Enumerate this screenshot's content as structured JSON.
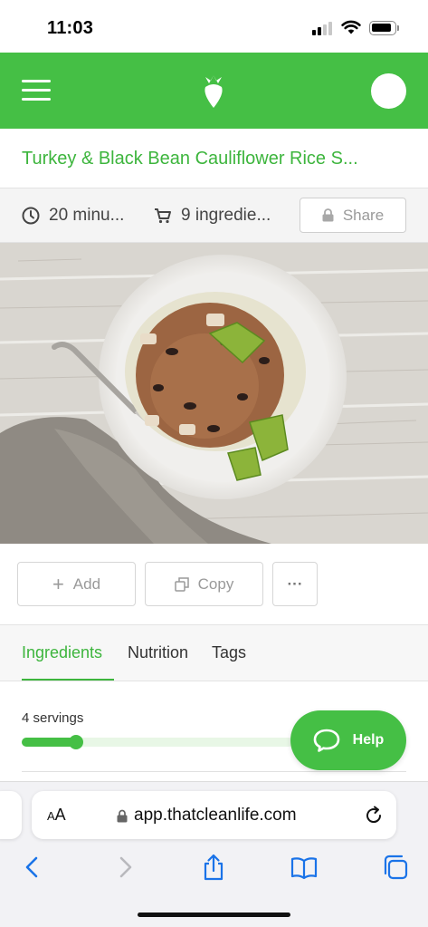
{
  "status_bar": {
    "time": "11:03"
  },
  "header": {
    "menu_icon": "hamburger-menu-icon",
    "logo_icon": "carrot-logo-icon",
    "avatar_icon": "user-avatar",
    "color": "#45bf45"
  },
  "recipe": {
    "title": "Turkey & Black Bean Cauliflower Rice S...",
    "time_label": "20 minu...",
    "ingredients_label": "9 ingredie...",
    "share_label": "Share",
    "image_alt": "Turkey and black bean bowl with cauliflower rice and avocado"
  },
  "actions": {
    "add_label": "Add",
    "copy_label": "Copy",
    "more_label": "···"
  },
  "tabs": [
    {
      "label": "Ingredients",
      "active": true
    },
    {
      "label": "Nutrition",
      "active": false
    },
    {
      "label": "Tags",
      "active": false
    }
  ],
  "servings": {
    "label": "4 servings",
    "value": 4,
    "fill_fraction": 0.2
  },
  "help": {
    "label": "Help"
  },
  "browser": {
    "aa_label": "AA",
    "url": "app.thatcleanlife.com",
    "accent": "#1a73e8"
  }
}
